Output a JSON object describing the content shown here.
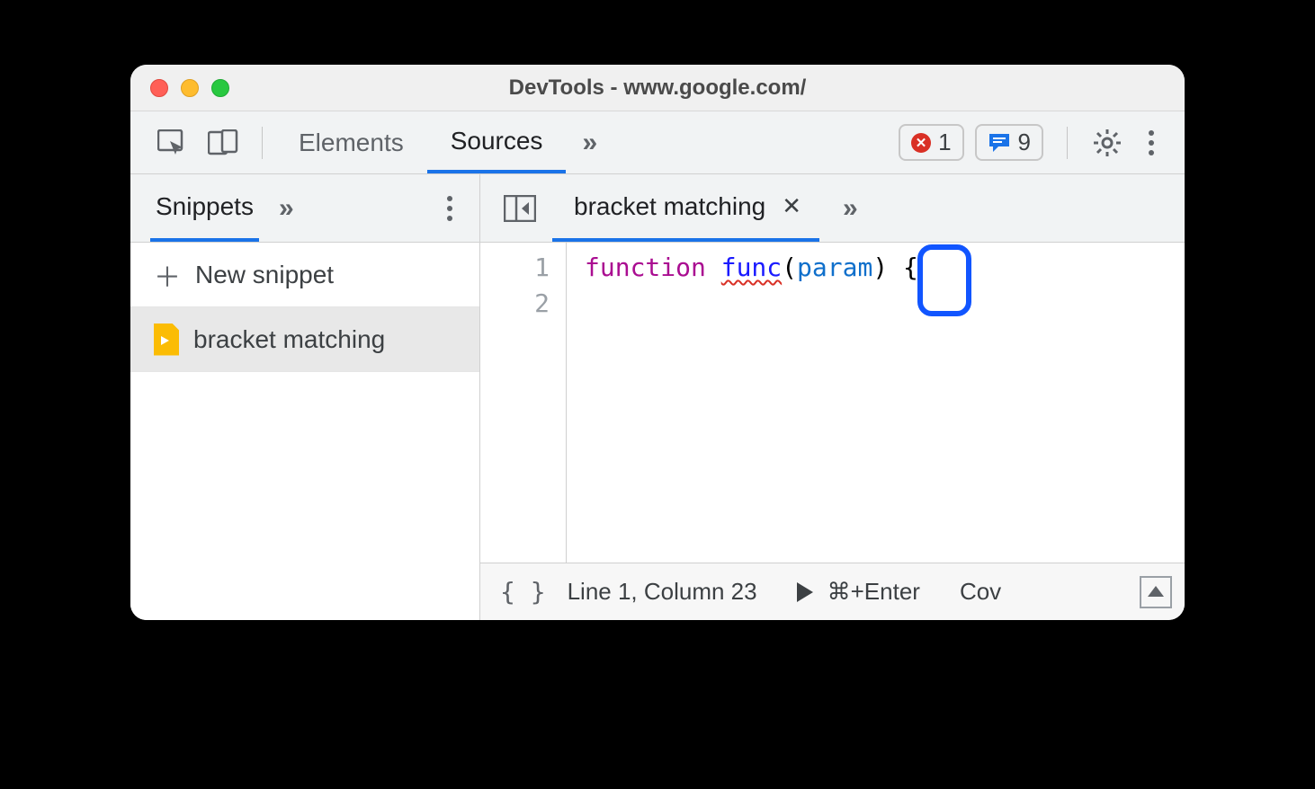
{
  "window": {
    "title": "DevTools - www.google.com/"
  },
  "toolbar": {
    "tab_elements": "Elements",
    "tab_sources": "Sources",
    "overflow": "»",
    "error_count": "1",
    "message_count": "9"
  },
  "sidebar": {
    "active_tab": "Snippets",
    "overflow": "»",
    "new_snippet": "New snippet",
    "items": [
      {
        "label": "bracket matching"
      }
    ]
  },
  "file_tabs": {
    "active": "bracket matching",
    "overflow": "»"
  },
  "editor": {
    "gutter": [
      "1",
      "2"
    ],
    "tokens": {
      "keyword": "function",
      "name": "func",
      "open_paren": "(",
      "param": "param",
      "close_paren": ")",
      "space": " ",
      "brace": "{"
    }
  },
  "statusbar": {
    "braces": "{ }",
    "position": "Line 1, Column 23",
    "run_shortcut": "⌘+Enter",
    "coverage": "Cov"
  }
}
